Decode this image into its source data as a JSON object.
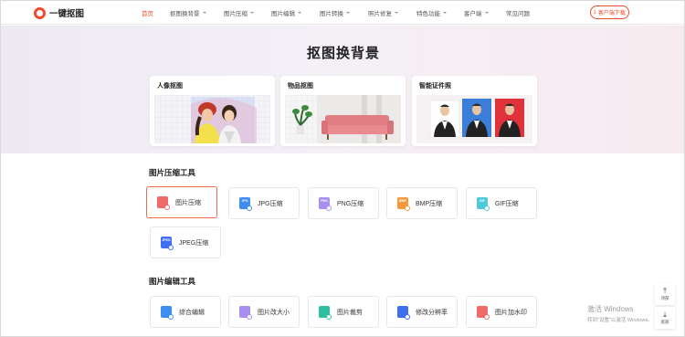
{
  "navbar": {
    "logo_text": "一键抠图",
    "items": [
      {
        "label": "首页",
        "active": true,
        "dropdown": false
      },
      {
        "label": "抠图换背景",
        "active": false,
        "dropdown": true
      },
      {
        "label": "图片压缩",
        "active": false,
        "dropdown": true
      },
      {
        "label": "图片编辑",
        "active": false,
        "dropdown": true
      },
      {
        "label": "图片转换",
        "active": false,
        "dropdown": true
      },
      {
        "label": "照片修复",
        "active": false,
        "dropdown": true
      },
      {
        "label": "特色功能",
        "active": false,
        "dropdown": true
      },
      {
        "label": "客户端",
        "active": false,
        "dropdown": true
      },
      {
        "label": "常见问题",
        "active": false,
        "dropdown": false
      }
    ],
    "download_label": "客户端下载",
    "accent_color": "#ef4b2b"
  },
  "hero": {
    "title": "抠图换背景",
    "cards": [
      {
        "title": "人像抠图"
      },
      {
        "title": "物品抠图"
      },
      {
        "title": "智能证件照"
      }
    ]
  },
  "compress_section": {
    "title": "图片压缩工具",
    "tools": [
      {
        "label": "图片压缩",
        "icon": "image-compress-icon",
        "color": "#f06a6a",
        "badge": ""
      },
      {
        "label": "JPG压缩",
        "icon": "jpg-icon",
        "color": "#3d8ef0",
        "badge": "JPG"
      },
      {
        "label": "PNG压缩",
        "icon": "png-icon",
        "color": "#a88ef0",
        "badge": "PNG"
      },
      {
        "label": "BMP压缩",
        "icon": "bmp-icon",
        "color": "#f59a3c",
        "badge": "BMP"
      },
      {
        "label": "GIF压缩",
        "icon": "gif-icon",
        "color": "#4ec9d8",
        "badge": "GIF"
      },
      {
        "label": "JPEG压缩",
        "icon": "jpeg-icon",
        "color": "#3d6ff0",
        "badge": "JPEG"
      }
    ]
  },
  "edit_section": {
    "title": "图片编辑工具",
    "tools": [
      {
        "label": "综合编辑",
        "icon": "edit-icon",
        "color": "#3d8ef0"
      },
      {
        "label": "图片改大小",
        "icon": "resize-icon",
        "color": "#a88ef0"
      },
      {
        "label": "图片裁剪",
        "icon": "crop-icon",
        "color": "#2fc0a0"
      },
      {
        "label": "修改分辨率",
        "icon": "resolution-icon",
        "color": "#3d6ff0"
      },
      {
        "label": "图片加水印",
        "icon": "watermark-icon",
        "color": "#f06a6a"
      }
    ]
  },
  "side": {
    "top_label": "顶部",
    "bottom_label": "底部"
  },
  "watermark": {
    "line1": "激活 Windows",
    "line2": "转到\"设置\"以激活 Windows。"
  }
}
